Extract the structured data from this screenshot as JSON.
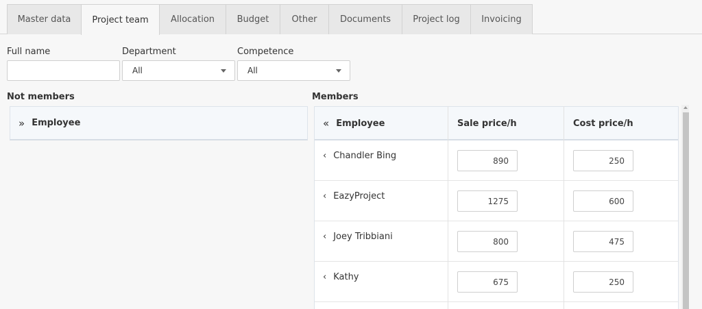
{
  "tabs": [
    {
      "label": "Master data",
      "active": false
    },
    {
      "label": "Project team",
      "active": true
    },
    {
      "label": "Allocation",
      "active": false
    },
    {
      "label": "Budget",
      "active": false
    },
    {
      "label": "Other",
      "active": false
    },
    {
      "label": "Documents",
      "active": false
    },
    {
      "label": "Project log",
      "active": false
    },
    {
      "label": "Invoicing",
      "active": false
    }
  ],
  "filters": {
    "full_name": {
      "label": "Full name",
      "value": ""
    },
    "department": {
      "label": "Department",
      "value": "All"
    },
    "competence": {
      "label": "Competence",
      "value": "All"
    }
  },
  "not_members": {
    "title": "Not members",
    "header": {
      "icon": "double-chevron-right-icon",
      "label": "Employee"
    }
  },
  "members": {
    "title": "Members",
    "columns": {
      "employee": {
        "icon": "double-chevron-left-icon",
        "label": "Employee"
      },
      "sale": "Sale price/h",
      "cost": "Cost price/h"
    },
    "rows": [
      {
        "name": "Chandler Bing",
        "sale": "890",
        "cost": "250"
      },
      {
        "name": "EazyProject",
        "sale": "1275",
        "cost": "600"
      },
      {
        "name": "Joey Tribbiani",
        "sale": "800",
        "cost": "475"
      },
      {
        "name": "Kathy",
        "sale": "675",
        "cost": "250"
      }
    ]
  },
  "glyphs": {
    "double_right": "»",
    "double_left": "«",
    "single_left": "‹"
  }
}
